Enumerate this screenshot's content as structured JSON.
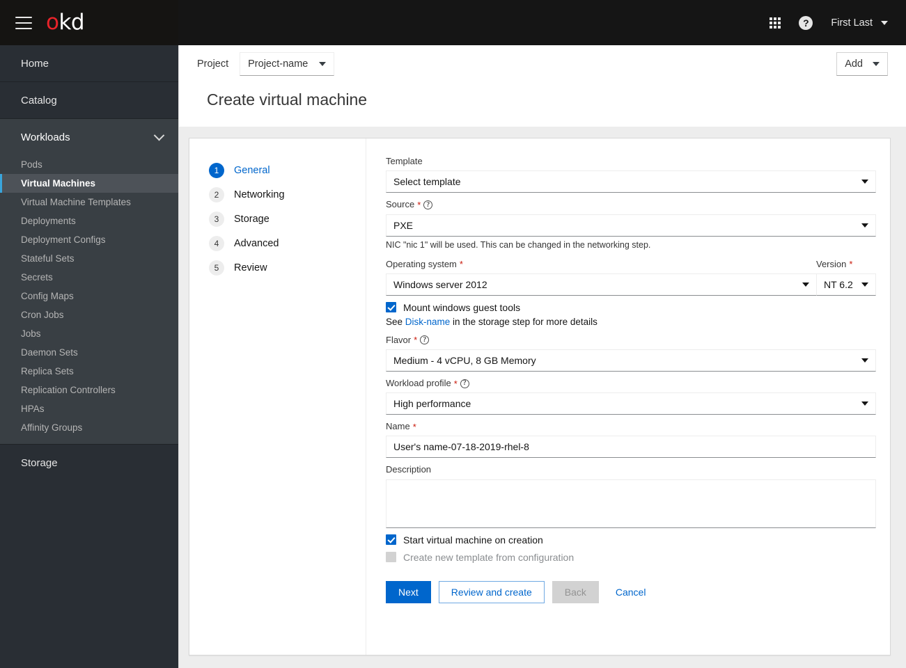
{
  "masthead": {
    "logo_o": "o",
    "logo_rest": "kd",
    "menu_icon": "hamburger-icon",
    "apps_icon": "grid-icon",
    "help_icon": "?",
    "user_name": "First Last"
  },
  "sidebar": {
    "top_items": [
      {
        "label": "Home"
      },
      {
        "label": "Catalog"
      }
    ],
    "group": {
      "label": "Workloads",
      "expanded": true,
      "items": [
        {
          "label": "Pods",
          "active": false
        },
        {
          "label": "Virtual Machines",
          "active": true
        },
        {
          "label": "Virtual Machine Templates",
          "active": false
        },
        {
          "label": "Deployments",
          "active": false
        },
        {
          "label": "Deployment Configs",
          "active": false
        },
        {
          "label": "Stateful Sets",
          "active": false
        },
        {
          "label": "Secrets",
          "active": false
        },
        {
          "label": "Config Maps",
          "active": false
        },
        {
          "label": "Cron Jobs",
          "active": false
        },
        {
          "label": "Jobs",
          "active": false
        },
        {
          "label": "Daemon Sets",
          "active": false
        },
        {
          "label": "Replica Sets",
          "active": false
        },
        {
          "label": "Replication Controllers",
          "active": false
        },
        {
          "label": "HPAs",
          "active": false
        },
        {
          "label": "Affinity Groups",
          "active": false
        }
      ]
    },
    "bottom_item": {
      "label": "Storage"
    }
  },
  "page": {
    "project_label": "Project",
    "project_value": "Project-name",
    "add_button": "Add",
    "title": "Create virtual machine"
  },
  "wizard": {
    "steps": [
      {
        "num": "1",
        "label": "General",
        "active": true
      },
      {
        "num": "2",
        "label": "Networking",
        "active": false
      },
      {
        "num": "3",
        "label": "Storage",
        "active": false
      },
      {
        "num": "4",
        "label": "Advanced",
        "active": false
      },
      {
        "num": "5",
        "label": "Review",
        "active": false
      }
    ],
    "fields": {
      "template_label": "Template",
      "template_value": "Select template",
      "source_label": "Source",
      "source_value": "PXE",
      "source_helper": "NIC \"nic 1\" will be used. This can be changed in the networking step.",
      "os_label": "Operating system",
      "os_value": "Windows server 2012",
      "version_label": "Version",
      "version_value": "NT 6.2",
      "mount_tools_label": "Mount windows guest tools",
      "mount_tools_checked": true,
      "disk_note_pre": "See ",
      "disk_note_link": "Disk-name",
      "disk_note_post": " in the storage step for more details",
      "flavor_label": "Flavor",
      "flavor_value": "Medium - 4 vCPU, 8 GB Memory",
      "workload_label": "Workload profile",
      "workload_value": "High performance",
      "name_label": "Name",
      "name_value": "User's name-07-18-2019-rhel-8",
      "description_label": "Description",
      "description_value": "",
      "start_vm_label": "Start virtual machine on creation",
      "start_vm_checked": true,
      "create_template_label": "Create new template from configuration",
      "create_template_checked": false,
      "create_template_disabled": true
    },
    "buttons": {
      "next": "Next",
      "review_and_create": "Review and create",
      "back": "Back",
      "cancel": "Cancel"
    }
  },
  "colors": {
    "accent_blue": "#0066cc",
    "brand_red": "#e8232a",
    "masthead_bg": "#151515",
    "sidebar_bg": "#393f44",
    "required_red": "#c9190b"
  }
}
